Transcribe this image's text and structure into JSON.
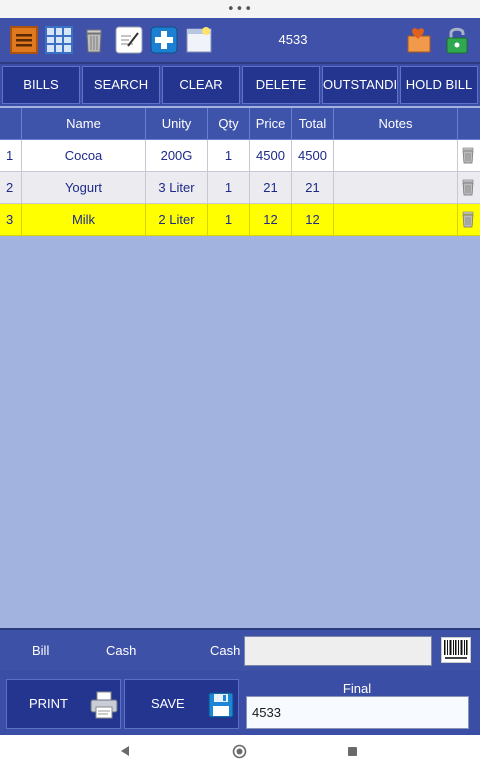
{
  "status": {
    "dots": "•••"
  },
  "toolbar": {
    "title": "4533",
    "icons": [
      "menu-icon",
      "grid-icon",
      "trash-icon",
      "notes-edit-icon",
      "add-icon",
      "window-icon",
      "user-heart-icon",
      "unlock-icon"
    ]
  },
  "buttons": {
    "bills": "BILLS",
    "search": "SEARCH",
    "clear": "CLEAR",
    "delete": "DELETE",
    "outstanding": "OUTSTANDI",
    "hold": "HOLD BILL"
  },
  "table": {
    "headers": {
      "num": "",
      "name": "Name",
      "unity": "Unity",
      "qty": "Qty",
      "price": "Price",
      "total": "Total",
      "notes": "Notes"
    },
    "rows": [
      {
        "num": "1",
        "name": "Cocoa",
        "unity": "200G",
        "qty": "1",
        "price": "4500",
        "total": "4500",
        "notes": "",
        "selected": false
      },
      {
        "num": "2",
        "name": "Yogurt",
        "unity": "3 Liter",
        "qty": "1",
        "price": "21",
        "total": "21",
        "notes": "",
        "selected": false
      },
      {
        "num": "3",
        "name": "Milk",
        "unity": "2 Liter",
        "qty": "1",
        "price": "12",
        "total": "12",
        "notes": "",
        "selected": true
      }
    ]
  },
  "footer": {
    "bill_label": "Bill",
    "cash_label": "Cash",
    "cash_field_label": "Cash",
    "cash_value": "",
    "print_label": "PRINT",
    "save_label": "SAVE",
    "final_label": "Final",
    "final_value": "4533"
  },
  "colors": {
    "toolbar": "#3f51a8",
    "button": "#24358f",
    "selected_row": "#ffff00",
    "content_bg": "#a3b3e0"
  }
}
